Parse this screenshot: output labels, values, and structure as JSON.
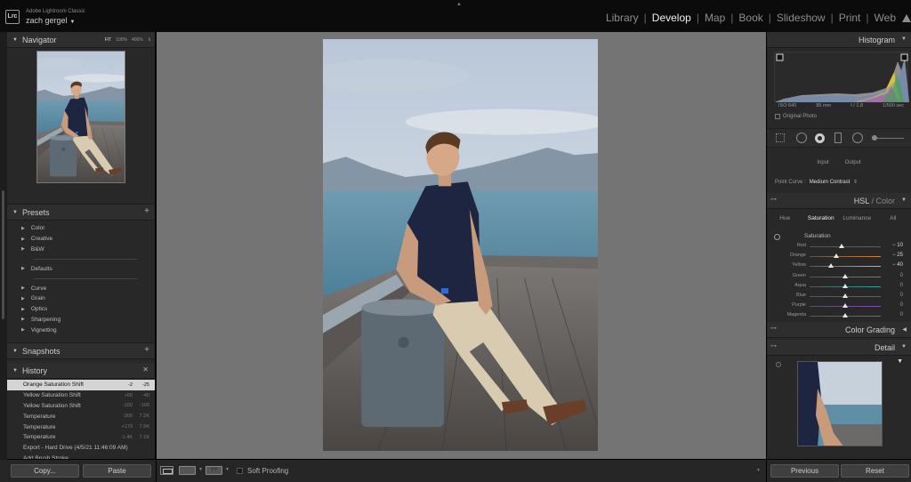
{
  "app": {
    "badge": "Lrc",
    "name": "Adobe Lightroom Classic",
    "user": "zach gergel",
    "user_caret": "▼"
  },
  "modules": [
    "Library",
    "Develop",
    "Map",
    "Book",
    "Slideshow",
    "Print",
    "Web"
  ],
  "active_module": "Develop",
  "navigator": {
    "title": "Navigator",
    "zoom": [
      "FIT",
      "100%",
      "400%"
    ]
  },
  "presets": {
    "title": "Presets",
    "group1": [
      "Color",
      "Creative",
      "B&W"
    ],
    "group2": [
      "Defaults"
    ],
    "group3": [
      "Curve",
      "Grain",
      "Optics",
      "Sharpening",
      "Vignetting"
    ]
  },
  "snapshots": {
    "title": "Snapshots"
  },
  "history": {
    "title": "History",
    "items": [
      {
        "name": "Orange Saturation Shift",
        "a": "-2",
        "b": "-25",
        "selected": true
      },
      {
        "name": "Yellow Saturation Shift",
        "a": "+60",
        "b": "-40"
      },
      {
        "name": "Yellow Saturation Shift",
        "a": "-100",
        "b": "-100"
      },
      {
        "name": "Temperature",
        "a": "-300",
        "b": "7.2K"
      },
      {
        "name": "Temperature",
        "a": "+179",
        "b": "7.5K"
      },
      {
        "name": "Temperature",
        "a": "-1.4K",
        "b": "7.1K"
      },
      {
        "name": "Export - Hard Drive (4/5/21 11:46:09 AM)",
        "a": "",
        "b": ""
      },
      {
        "name": "Add Brush Stroke",
        "a": "",
        "b": ""
      },
      {
        "name": "Add Brush Stroke",
        "a": "",
        "b": ""
      }
    ]
  },
  "left_buttons": {
    "copy": "Copy...",
    "paste": "Paste"
  },
  "toolbar": {
    "yy_label": "YY",
    "soft_proofing": "Soft Proofing"
  },
  "histogram": {
    "title": "Histogram",
    "iso": "ISO 640",
    "focal": "85 mm",
    "aperture": "f / 1.8",
    "shutter": "1/500 sec",
    "original_photo": "Original Photo"
  },
  "tone_curve": {
    "input": "Input",
    "output": "Output",
    "point_curve_label": "Point Curve :",
    "point_curve_value": "Medium Contrast"
  },
  "hsl": {
    "title_hsl": "HSL",
    "title_color": "Color",
    "tabs": [
      "Hue",
      "Saturation",
      "Luminance",
      "All"
    ],
    "active_tab": "Saturation",
    "section": "Saturation",
    "sliders": [
      {
        "name": "Red",
        "value": -10,
        "label": "− 10",
        "color": "#c0392b"
      },
      {
        "name": "Orange",
        "value": -25,
        "label": "− 25",
        "color": "#d9822b"
      },
      {
        "name": "Yellow",
        "value": -40,
        "label": "− 40",
        "color": "#d8c62e"
      },
      {
        "name": "Green",
        "value": 0,
        "label": "0",
        "color": "#3fa34d"
      },
      {
        "name": "Aqua",
        "value": 0,
        "label": "0",
        "color": "#2fa7a7"
      },
      {
        "name": "Blue",
        "value": 0,
        "label": "0",
        "color": "#3468c7"
      },
      {
        "name": "Purple",
        "value": 0,
        "label": "0",
        "color": "#8a47b9"
      },
      {
        "name": "Magenta",
        "value": 0,
        "label": "0",
        "color": "#c23fa0"
      }
    ]
  },
  "color_grading": {
    "title": "Color Grading"
  },
  "detail": {
    "title": "Detail"
  },
  "right_buttons": {
    "previous": "Previous",
    "reset": "Reset"
  }
}
